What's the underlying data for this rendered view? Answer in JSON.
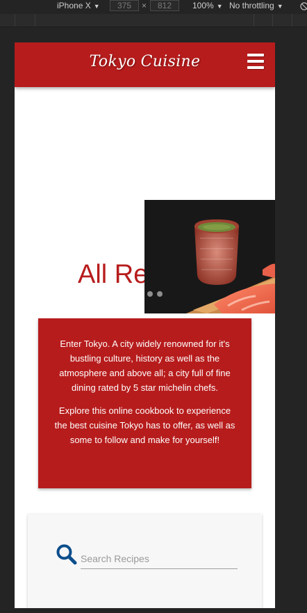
{
  "devtools": {
    "device": "iPhone X",
    "width": "375",
    "times": "×",
    "height": "812",
    "zoom": "100%",
    "throttling": "No throttling"
  },
  "site": {
    "brand": "Tokyo Cuisine",
    "heading": "All Re",
    "intro": [
      "Enter Tokyo. A city widely renowned for it's bustling culture, history as well as the atmosphere and above all; a city full of fine dining rated by 5 star michelin chefs.",
      "Explore this online cookbook to experience the best cuisine Tokyo has to offer, as well as some to follow and make for yourself!"
    ],
    "search": {
      "placeholder": "Search Recipes"
    }
  },
  "colors": {
    "brand": "#b71c1c",
    "search_icon": "#0d4e8c"
  }
}
